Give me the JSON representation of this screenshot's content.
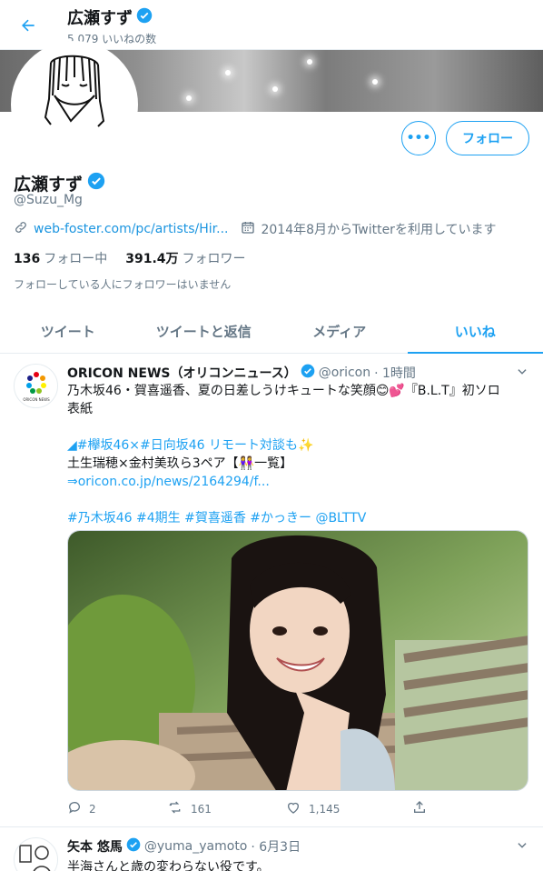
{
  "header": {
    "name": "広瀬すず",
    "likes_count": "5,079 いいねの数"
  },
  "profile": {
    "name": "広瀬すず",
    "handle": "@Suzu_Mg",
    "website": "web-foster.com/pc/artists/Hir...",
    "joined": "2014年8月からTwitterを利用しています",
    "following_count": "136",
    "following_label": "フォロー中",
    "followers_count": "391.4万",
    "followers_label": "フォロワー",
    "note": "フォローしている人にフォロワーはいません",
    "more_label": "•••",
    "follow_label": "フォロー"
  },
  "tabs": [
    {
      "label": "ツイート"
    },
    {
      "label": "ツイートと返信"
    },
    {
      "label": "メディア"
    },
    {
      "label": "いいね"
    }
  ],
  "tweet": {
    "author": "ORICON NEWS（オリコンニュース）",
    "handle": "@oricon",
    "time": "· 1時間",
    "lines": [
      "乃木坂46・賀喜遥香、夏の日差しうけキュートな笑顔😊💕『B.L.T』初ソロ",
      "表紙",
      "",
      "◢#欅坂46×#日向坂46 リモート対談も✨",
      "土生瑞穂×金村美玖ら3ペア【👭一覧】",
      "⇒oricon.co.jp/news/2164294/f...",
      "",
      "#乃木坂46 #4期生 #賀喜遥香 #かっきー @BLTTV"
    ],
    "replies": "2",
    "retweets": "161",
    "likes": "1,145",
    "avatar_text": "ORICON NEWS"
  },
  "tweet2": {
    "author": "矢本 悠馬",
    "handle": "@yuma_yamoto",
    "time": "· 6月3日",
    "text": "半海さんと歳の変わらない役です。"
  },
  "colors": {
    "accent": "#1da1f2",
    "text": "#14171a",
    "muted": "#657786"
  }
}
